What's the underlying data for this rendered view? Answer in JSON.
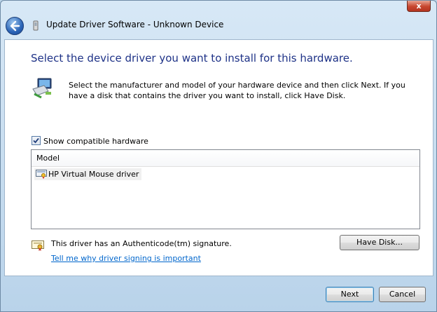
{
  "window": {
    "title": "Update Driver Software - Unknown Device",
    "close_glyph": "x"
  },
  "heading": "Select the device driver you want to install for this hardware.",
  "instruction": "Select the manufacturer and model of your hardware device and then click Next. If you have a disk that contains the driver you want to install, click Have Disk.",
  "show_compatible": {
    "label": "Show compatible hardware",
    "checked": true
  },
  "list": {
    "header": "Model",
    "items": [
      {
        "label": "HP Virtual Mouse driver",
        "selected": true
      }
    ]
  },
  "signature": {
    "text": "This driver has an Authenticode(tm) signature.",
    "link": "Tell me why driver signing is important"
  },
  "buttons": {
    "have_disk": "Have Disk...",
    "next": "Next",
    "cancel": "Cancel"
  },
  "icons": {
    "back": "back-arrow-icon",
    "title": "device-icon",
    "hardware": "hardware-driver-icon",
    "list_item": "driver-icon",
    "certificate": "certificate-icon"
  },
  "colors": {
    "heading": "#1e3287",
    "link": "#0066cc",
    "close": "#c7462f"
  }
}
